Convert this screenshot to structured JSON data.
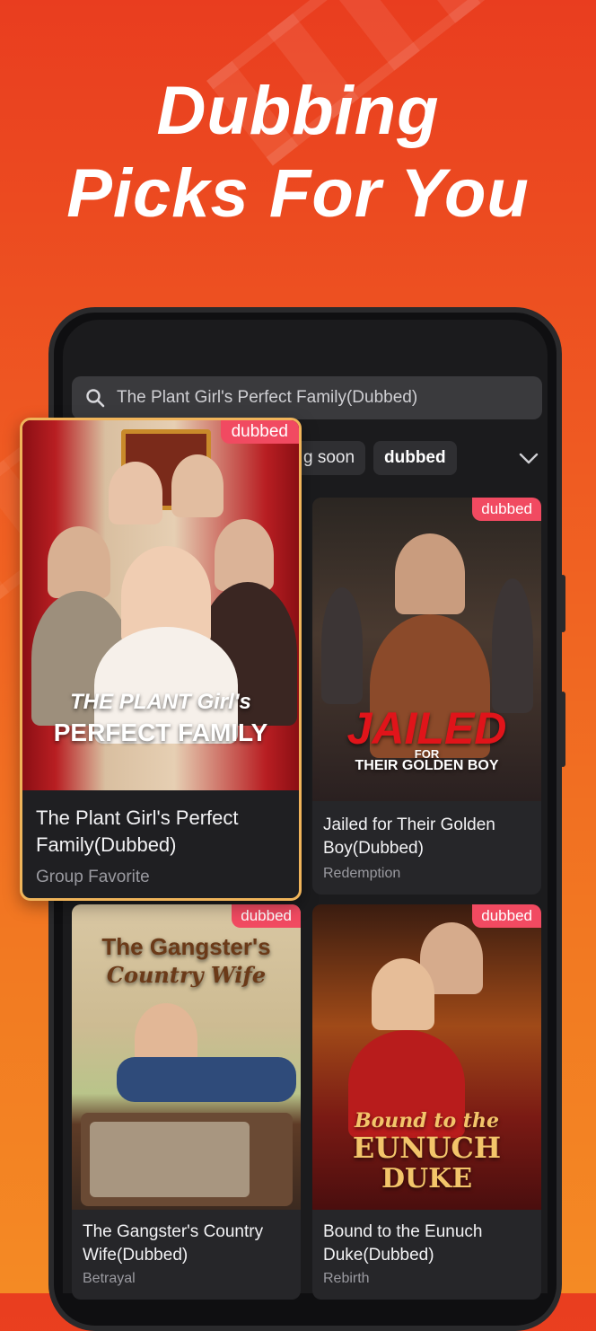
{
  "headline": {
    "line1": "Dubbing",
    "line2": "Picks For You"
  },
  "search": {
    "query": "The Plant Girl's Perfect Family(Dubbed)",
    "icon": "search-icon"
  },
  "filters": {
    "chips": [
      {
        "label": "g soon",
        "active": false
      },
      {
        "label": "dubbed",
        "active": true
      }
    ],
    "expand_icon": "chevron-down-icon"
  },
  "featured": {
    "badge": "dubbed",
    "poster_text_line1": "THE PLANT Girl's",
    "poster_text_line2": "PERFECT FAMILY",
    "title": "The Plant Girl's Perfect Family(Dubbed)",
    "subtitle": "Group Favorite"
  },
  "grid": [
    {
      "badge": "dubbed",
      "poster_text_line1": "JAILED",
      "poster_text_line2": "FOR",
      "poster_text_line3": "THEIR GOLDEN BOY",
      "title": "Jailed for Their Golden Boy(Dubbed)",
      "subtitle": "Redemption"
    },
    {
      "badge": "dubbed",
      "poster_text_line1": "The Gangster's",
      "poster_text_line2": "Country Wife",
      "title": "The Gangster's Country Wife(Dubbed)",
      "subtitle": "Betrayal"
    },
    {
      "badge": "dubbed",
      "poster_text_line1": "Bound to the",
      "poster_text_line2": "EUNUCH",
      "poster_text_line3": "DUKE",
      "title": "Bound to the Eunuch Duke(Dubbed)",
      "subtitle": "Rebirth"
    }
  ],
  "colors": {
    "accent_badge": "#f14a61",
    "highlight_border": "#f0b45a",
    "background_top": "#e93d1f",
    "background_bottom": "#f48a24"
  }
}
